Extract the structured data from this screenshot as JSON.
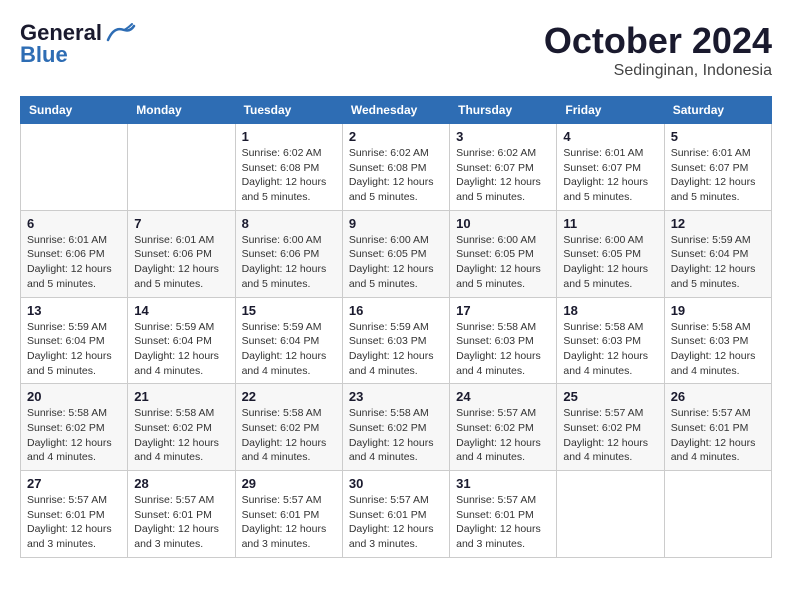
{
  "header": {
    "logo_general": "General",
    "logo_blue": "Blue",
    "month": "October 2024",
    "location": "Sedinginan, Indonesia"
  },
  "days_of_week": [
    "Sunday",
    "Monday",
    "Tuesday",
    "Wednesday",
    "Thursday",
    "Friday",
    "Saturday"
  ],
  "weeks": [
    [
      {
        "day": "",
        "info": ""
      },
      {
        "day": "",
        "info": ""
      },
      {
        "day": "1",
        "info": "Sunrise: 6:02 AM\nSunset: 6:08 PM\nDaylight: 12 hours and 5 minutes."
      },
      {
        "day": "2",
        "info": "Sunrise: 6:02 AM\nSunset: 6:08 PM\nDaylight: 12 hours and 5 minutes."
      },
      {
        "day": "3",
        "info": "Sunrise: 6:02 AM\nSunset: 6:07 PM\nDaylight: 12 hours and 5 minutes."
      },
      {
        "day": "4",
        "info": "Sunrise: 6:01 AM\nSunset: 6:07 PM\nDaylight: 12 hours and 5 minutes."
      },
      {
        "day": "5",
        "info": "Sunrise: 6:01 AM\nSunset: 6:07 PM\nDaylight: 12 hours and 5 minutes."
      }
    ],
    [
      {
        "day": "6",
        "info": "Sunrise: 6:01 AM\nSunset: 6:06 PM\nDaylight: 12 hours and 5 minutes."
      },
      {
        "day": "7",
        "info": "Sunrise: 6:01 AM\nSunset: 6:06 PM\nDaylight: 12 hours and 5 minutes."
      },
      {
        "day": "8",
        "info": "Sunrise: 6:00 AM\nSunset: 6:06 PM\nDaylight: 12 hours and 5 minutes."
      },
      {
        "day": "9",
        "info": "Sunrise: 6:00 AM\nSunset: 6:05 PM\nDaylight: 12 hours and 5 minutes."
      },
      {
        "day": "10",
        "info": "Sunrise: 6:00 AM\nSunset: 6:05 PM\nDaylight: 12 hours and 5 minutes."
      },
      {
        "day": "11",
        "info": "Sunrise: 6:00 AM\nSunset: 6:05 PM\nDaylight: 12 hours and 5 minutes."
      },
      {
        "day": "12",
        "info": "Sunrise: 5:59 AM\nSunset: 6:04 PM\nDaylight: 12 hours and 5 minutes."
      }
    ],
    [
      {
        "day": "13",
        "info": "Sunrise: 5:59 AM\nSunset: 6:04 PM\nDaylight: 12 hours and 5 minutes."
      },
      {
        "day": "14",
        "info": "Sunrise: 5:59 AM\nSunset: 6:04 PM\nDaylight: 12 hours and 4 minutes."
      },
      {
        "day": "15",
        "info": "Sunrise: 5:59 AM\nSunset: 6:04 PM\nDaylight: 12 hours and 4 minutes."
      },
      {
        "day": "16",
        "info": "Sunrise: 5:59 AM\nSunset: 6:03 PM\nDaylight: 12 hours and 4 minutes."
      },
      {
        "day": "17",
        "info": "Sunrise: 5:58 AM\nSunset: 6:03 PM\nDaylight: 12 hours and 4 minutes."
      },
      {
        "day": "18",
        "info": "Sunrise: 5:58 AM\nSunset: 6:03 PM\nDaylight: 12 hours and 4 minutes."
      },
      {
        "day": "19",
        "info": "Sunrise: 5:58 AM\nSunset: 6:03 PM\nDaylight: 12 hours and 4 minutes."
      }
    ],
    [
      {
        "day": "20",
        "info": "Sunrise: 5:58 AM\nSunset: 6:02 PM\nDaylight: 12 hours and 4 minutes."
      },
      {
        "day": "21",
        "info": "Sunrise: 5:58 AM\nSunset: 6:02 PM\nDaylight: 12 hours and 4 minutes."
      },
      {
        "day": "22",
        "info": "Sunrise: 5:58 AM\nSunset: 6:02 PM\nDaylight: 12 hours and 4 minutes."
      },
      {
        "day": "23",
        "info": "Sunrise: 5:58 AM\nSunset: 6:02 PM\nDaylight: 12 hours and 4 minutes."
      },
      {
        "day": "24",
        "info": "Sunrise: 5:57 AM\nSunset: 6:02 PM\nDaylight: 12 hours and 4 minutes."
      },
      {
        "day": "25",
        "info": "Sunrise: 5:57 AM\nSunset: 6:02 PM\nDaylight: 12 hours and 4 minutes."
      },
      {
        "day": "26",
        "info": "Sunrise: 5:57 AM\nSunset: 6:01 PM\nDaylight: 12 hours and 4 minutes."
      }
    ],
    [
      {
        "day": "27",
        "info": "Sunrise: 5:57 AM\nSunset: 6:01 PM\nDaylight: 12 hours and 3 minutes."
      },
      {
        "day": "28",
        "info": "Sunrise: 5:57 AM\nSunset: 6:01 PM\nDaylight: 12 hours and 3 minutes."
      },
      {
        "day": "29",
        "info": "Sunrise: 5:57 AM\nSunset: 6:01 PM\nDaylight: 12 hours and 3 minutes."
      },
      {
        "day": "30",
        "info": "Sunrise: 5:57 AM\nSunset: 6:01 PM\nDaylight: 12 hours and 3 minutes."
      },
      {
        "day": "31",
        "info": "Sunrise: 5:57 AM\nSunset: 6:01 PM\nDaylight: 12 hours and 3 minutes."
      },
      {
        "day": "",
        "info": ""
      },
      {
        "day": "",
        "info": ""
      }
    ]
  ]
}
